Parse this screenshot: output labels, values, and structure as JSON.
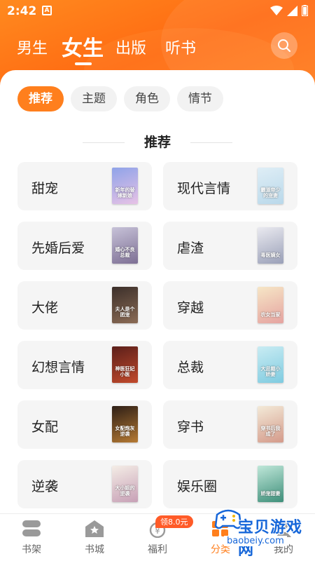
{
  "status_bar": {
    "time": "2:42",
    "notification_letter": "A"
  },
  "top_tabs": [
    {
      "label": "男生",
      "selected": false
    },
    {
      "label": "女生",
      "selected": true
    },
    {
      "label": "出版",
      "selected": false
    },
    {
      "label": "听书",
      "selected": false
    }
  ],
  "filter_chips": [
    {
      "label": "推荐",
      "selected": true
    },
    {
      "label": "主题",
      "selected": false
    },
    {
      "label": "角色",
      "selected": false
    },
    {
      "label": "情节",
      "selected": false
    }
  ],
  "section_title": "推荐",
  "categories": [
    {
      "label": "甜宠",
      "cover_title": "新年的替嫁新娘",
      "cover_colors": [
        "#8fa3e8",
        "#e7c2e6"
      ]
    },
    {
      "label": "现代言情",
      "cover_title": "霸道帝少的宠妻",
      "cover_colors": [
        "#dfeef6",
        "#b9d8ea"
      ]
    },
    {
      "label": "先婚后爱",
      "cover_title": "婚心不良总裁",
      "cover_colors": [
        "#c7c2d8",
        "#7d6f94"
      ]
    },
    {
      "label": "虐渣",
      "cover_title": "毒医嫡女",
      "cover_colors": [
        "#eaeaf0",
        "#9aa0b8"
      ]
    },
    {
      "label": "大佬",
      "cover_title": "夫人是个团宠",
      "cover_colors": [
        "#3b2f2a",
        "#8b6b55"
      ]
    },
    {
      "label": "穿越",
      "cover_title": "农女当家",
      "cover_colors": [
        "#f6e6c6",
        "#e5a3a0"
      ]
    },
    {
      "label": "幻想言情",
      "cover_title": "神医狂妃小医",
      "cover_colors": [
        "#5b1f1a",
        "#c24a2c"
      ]
    },
    {
      "label": "总裁",
      "cover_title": "大总裁小娇妻",
      "cover_colors": [
        "#c9ecf3",
        "#7fcbe0"
      ]
    },
    {
      "label": "女配",
      "cover_title": "女配炮灰逆袭",
      "cover_colors": [
        "#2d1e16",
        "#b67a33"
      ]
    },
    {
      "label": "穿书",
      "cover_title": "穿书后我成了",
      "cover_colors": [
        "#f3ead8",
        "#d49a8a"
      ]
    },
    {
      "label": "逆袭",
      "cover_title": "大小姐的逆袭",
      "cover_colors": [
        "#f4ede6",
        "#c7a0b6"
      ]
    },
    {
      "label": "娱乐圈",
      "cover_title": "娇宠甜妻",
      "cover_colors": [
        "#bfe7d9",
        "#3f8f7a"
      ]
    }
  ],
  "bottom_nav": [
    {
      "label": "书架",
      "icon": "bookshelf-icon"
    },
    {
      "label": "书城",
      "icon": "bookstore-icon"
    },
    {
      "label": "福利",
      "icon": "welfare-icon"
    },
    {
      "label": "分类",
      "icon": "category-icon"
    },
    {
      "label": "我的",
      "icon": "profile-icon"
    }
  ],
  "welfare_badge": "领8.0元",
  "watermark": {
    "title": "宝贝游戏网",
    "url": "baobeiy.com"
  },
  "colors": {
    "accent": "#ff7f1d",
    "header_start": "#ff8a1f",
    "header_end": "#ff6a12"
  }
}
